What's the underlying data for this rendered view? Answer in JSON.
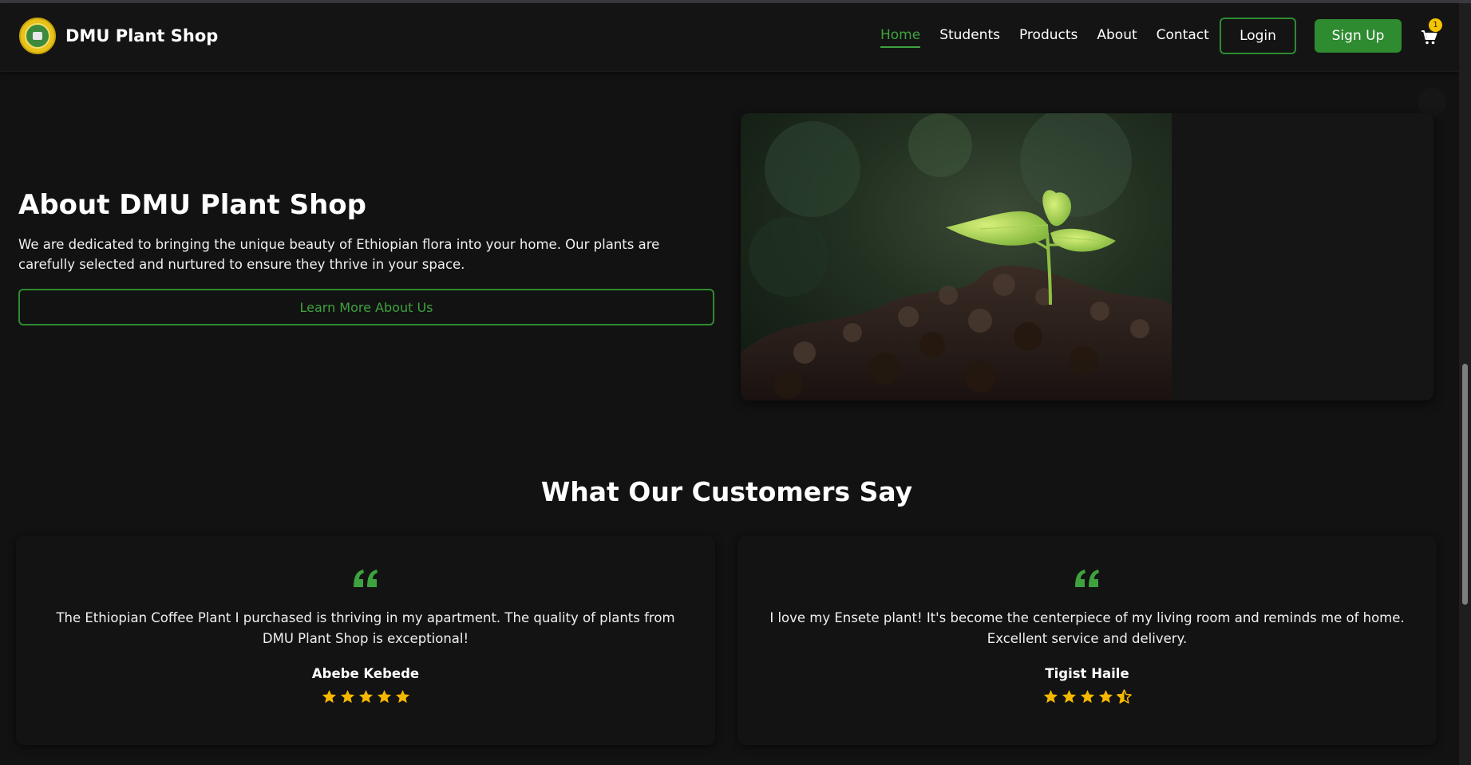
{
  "brand": {
    "name": "DMU Plant Shop"
  },
  "nav": {
    "items": [
      {
        "label": "Home",
        "active": true
      },
      {
        "label": "Students",
        "active": false
      },
      {
        "label": "Products",
        "active": false
      },
      {
        "label": "About",
        "active": false
      },
      {
        "label": "Contact",
        "active": false
      }
    ],
    "login_label": "Login",
    "signup_label": "Sign Up",
    "cart_count": "1"
  },
  "about": {
    "title": "About DMU Plant Shop",
    "text": "We are dedicated to bringing the unique beauty of Ethiopian flora into your home. Our plants are carefully selected and nurtured to ensure they thrive in your space.",
    "button_label": "Learn More About Us"
  },
  "testimonials": {
    "title": "What Our Customers Say",
    "items": [
      {
        "text": "The Ethiopian Coffee Plant I purchased is thriving in my apartment. The quality of plants from DMU Plant Shop is exceptional!",
        "name": "Abebe Kebede",
        "rating": 5
      },
      {
        "text": "I love my Ensete plant! It's become the centerpiece of my living room and reminds me of home. Excellent service and delivery.",
        "name": "Tigist Haile",
        "rating": 4.5
      }
    ]
  },
  "colors": {
    "background": "#121212",
    "accent_green": "#2e8b30",
    "active_link": "#3ea23f",
    "star": "#f5b800",
    "badge": "#f5c400"
  },
  "icons": [
    "logo-seal",
    "cart-icon",
    "quote-icon",
    "star-icon",
    "half-star-icon"
  ]
}
